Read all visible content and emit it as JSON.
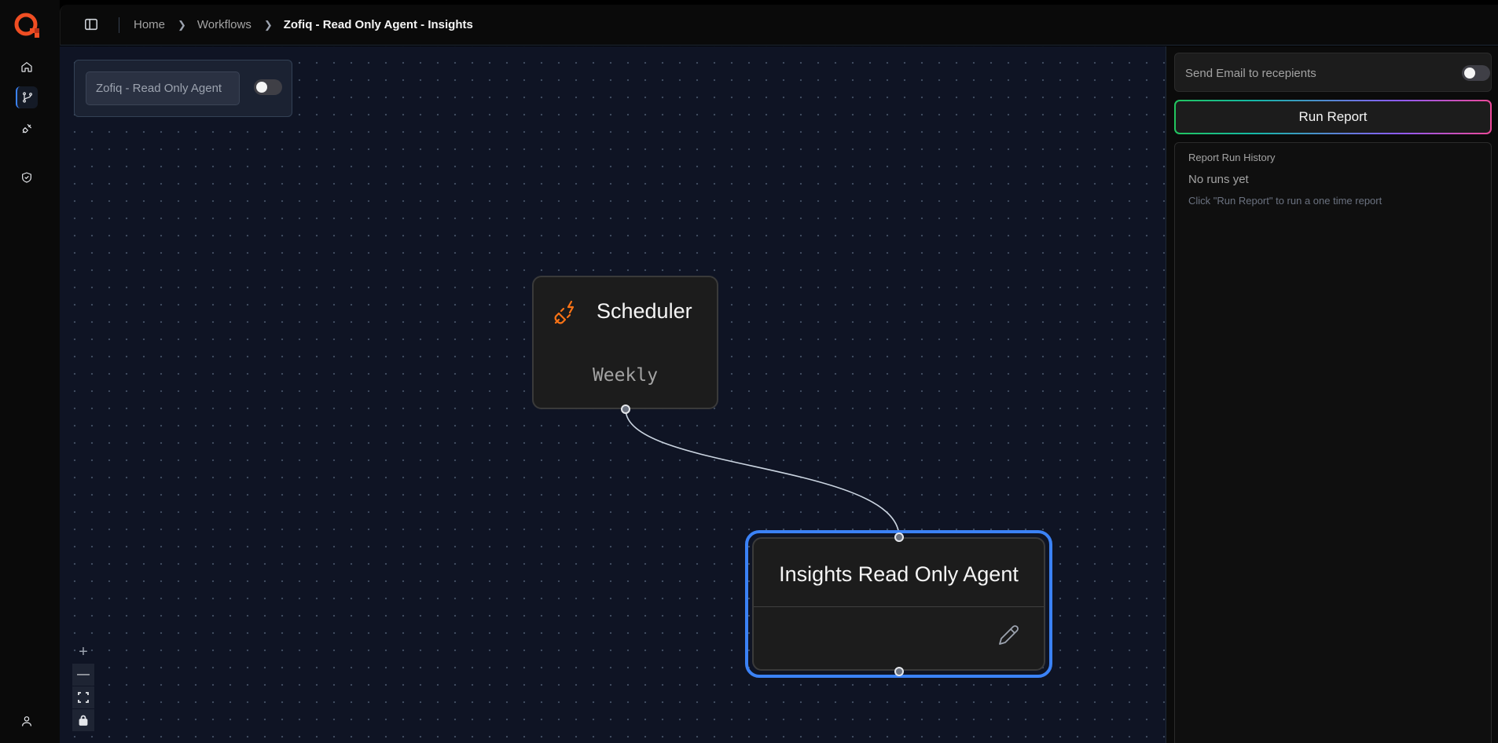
{
  "app": {
    "logo_icon": "zofiq-logo-icon",
    "nav": [
      {
        "name": "home-icon"
      },
      {
        "name": "workflow-icon"
      },
      {
        "name": "integrations-plug-icon"
      },
      {
        "name": "shield-check-icon"
      },
      {
        "name": "user-icon"
      }
    ]
  },
  "breadcrumb": {
    "home": "Home",
    "workflows": "Workflows",
    "current": "Zofiq - Read Only Agent - Insights"
  },
  "workflow_panel": {
    "name_value": "Zofiq - Read Only Agent",
    "enabled": false
  },
  "nodes": {
    "scheduler": {
      "title": "Scheduler",
      "subtitle": "Weekly",
      "icon": "plug-bolt-icon",
      "icon_color": "#f97316"
    },
    "agent": {
      "title": "Insights Read Only Agent",
      "selected": true,
      "select_color": "#3b82f6",
      "edit_icon": "pencil-icon"
    }
  },
  "zoom_controls": {
    "zoom_in": "+",
    "zoom_out": "—"
  },
  "right_panel": {
    "send_email_label": "Send Email to recepients",
    "send_email_enabled": false,
    "run_report_label": "Run Report",
    "history_title": "Report Run History",
    "empty_title": "No runs yet",
    "empty_hint": "Click \"Run Report\" to run a one time report"
  },
  "colors": {
    "canvas_bg": "#0f1424",
    "accent": "#3b82f6",
    "brand": "#f04e23"
  }
}
